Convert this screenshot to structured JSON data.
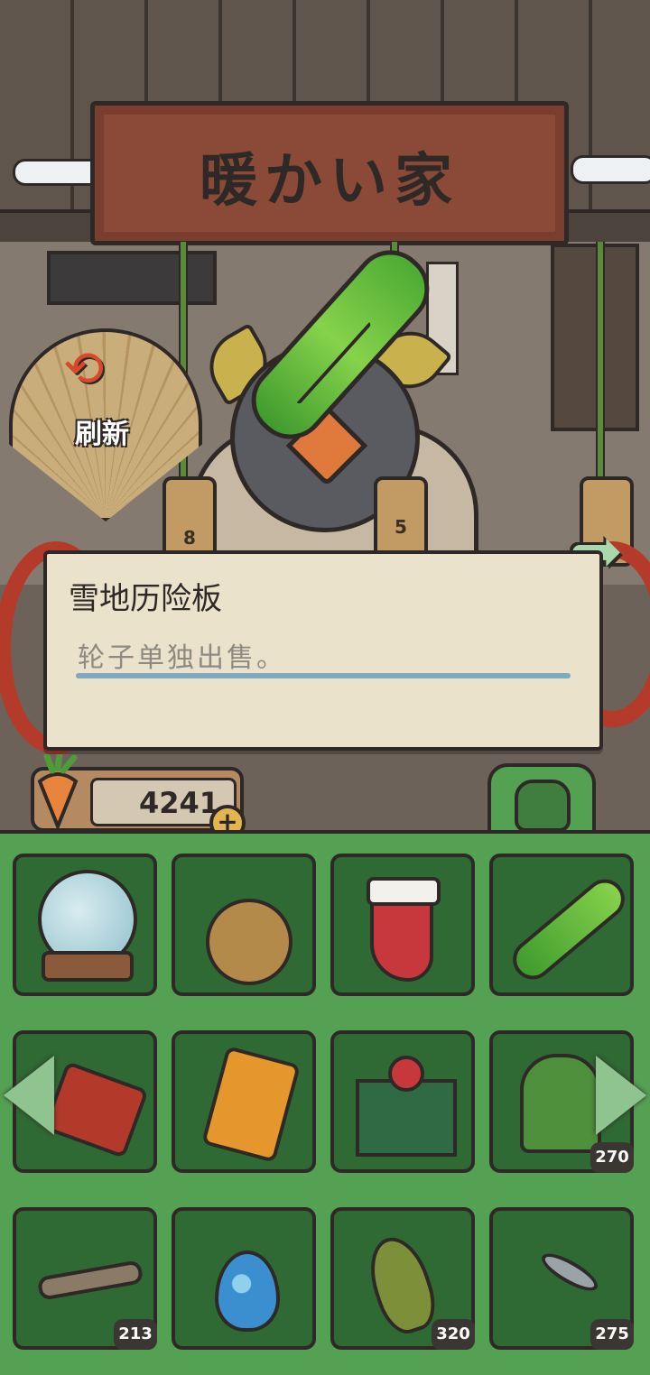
{
  "shop": {
    "sign_title": "暖かい家",
    "refresh_label": "刷新",
    "price_tags": [
      "8",
      "5"
    ]
  },
  "dialog": {
    "item_name": "雪地历险板",
    "item_description": "轮子单独出售。"
  },
  "currency": {
    "icon": "carrot-icon",
    "value": "4241",
    "add_label": "+"
  },
  "inventory": {
    "tab_icon": "backpack-icon",
    "slots": [
      {
        "icon": "snow-globe-icon",
        "count": ""
      },
      {
        "icon": "ornament-ball-icon",
        "count": ""
      },
      {
        "icon": "christmas-stocking-icon",
        "count": ""
      },
      {
        "icon": "snowboard-icon",
        "count": ""
      },
      {
        "icon": "lantern-icon",
        "count": ""
      },
      {
        "icon": "game-console-icon",
        "count": ""
      },
      {
        "icon": "gift-box-icon",
        "count": ""
      },
      {
        "icon": "seaweed-icon",
        "count": "270"
      },
      {
        "icon": "driftwood-icon",
        "count": "213"
      },
      {
        "icon": "spotted-egg-icon",
        "count": ""
      },
      {
        "icon": "perch-fish-icon",
        "count": "320"
      },
      {
        "icon": "small-fish-icon",
        "count": "275"
      }
    ]
  },
  "colors": {
    "inventory_bg": "#55a154",
    "slot_bg": "#2f6a34",
    "dialog_bg": "#ebe2cc",
    "outline": "#2e2926",
    "accent_red": "#b43a2a"
  }
}
